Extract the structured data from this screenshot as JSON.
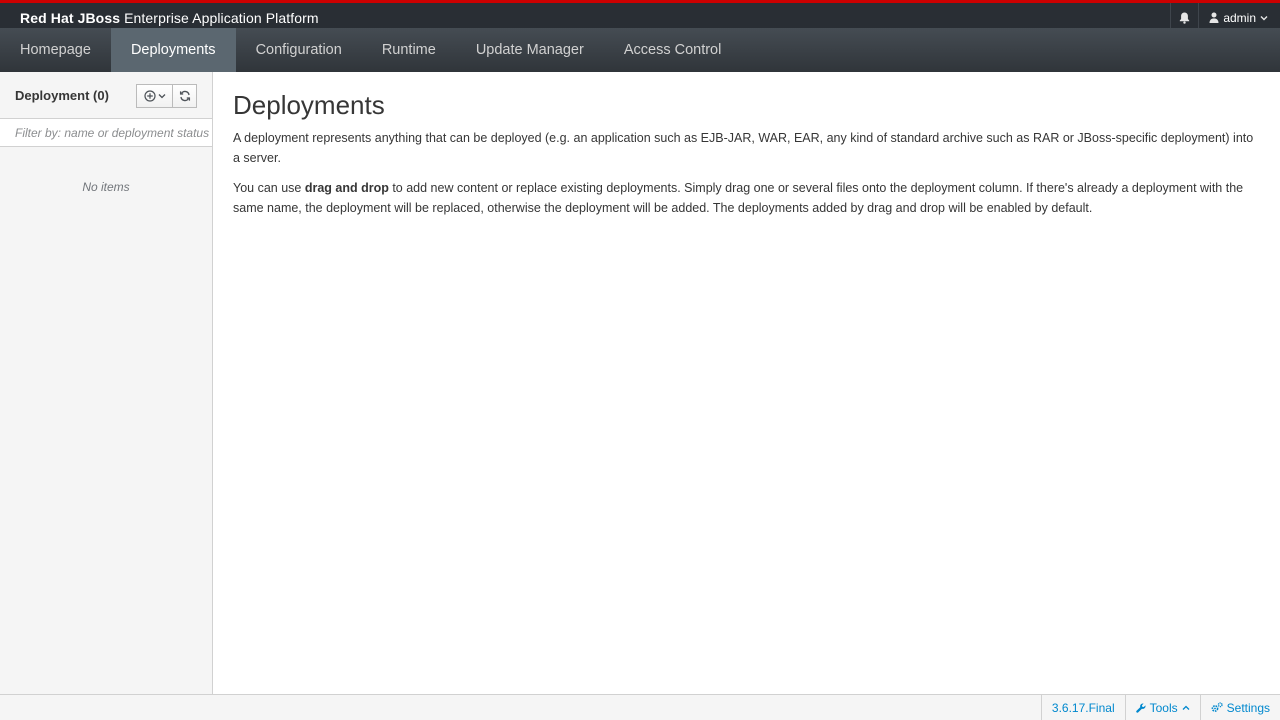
{
  "header": {
    "brand_bold": "Red Hat JBoss",
    "brand_rest": "Enterprise Application Platform",
    "user": "admin",
    "accent": "#cc0000"
  },
  "nav": {
    "items": [
      {
        "label": "Homepage",
        "active": false
      },
      {
        "label": "Deployments",
        "active": true
      },
      {
        "label": "Configuration",
        "active": false
      },
      {
        "label": "Runtime",
        "active": false
      },
      {
        "label": "Update Manager",
        "active": false
      },
      {
        "label": "Access Control",
        "active": false
      }
    ]
  },
  "sidebar": {
    "title": "Deployment (0)",
    "filter_placeholder": "Filter by: name or deployment status",
    "empty_text": "No items"
  },
  "content": {
    "title": "Deployments",
    "para1": "A deployment represents anything that can be deployed (e.g. an application such as EJB-JAR, WAR, EAR, any kind of standard archive such as RAR or JBoss-specific deployment) into a server.",
    "para2_pre": "You can use ",
    "para2_bold": "drag and drop",
    "para2_post": " to add new content or replace existing deployments. Simply drag one or several files onto the deployment column. If there's already a deployment with the same name, the deployment will be replaced, otherwise the deployment will be added. The deployments added by drag and drop will be enabled by default."
  },
  "footer": {
    "version": "3.6.17.Final",
    "tools": "Tools",
    "settings": "Settings",
    "link_color": "#0088ce"
  }
}
